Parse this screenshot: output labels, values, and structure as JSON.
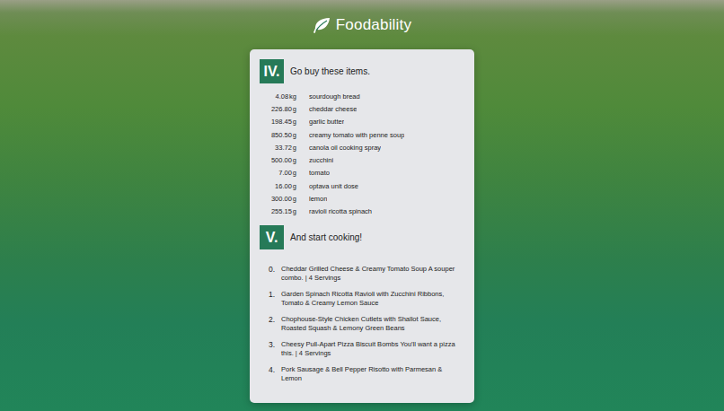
{
  "header": {
    "title": "Foodability"
  },
  "shopping": {
    "numeral": "IV.",
    "title": "Go buy these items.",
    "items": [
      {
        "amount": "4.08",
        "unit": "kg",
        "name": "sourdough bread"
      },
      {
        "amount": "226.80",
        "unit": "g",
        "name": "cheddar cheese"
      },
      {
        "amount": "198.45",
        "unit": "g",
        "name": "garlic butter"
      },
      {
        "amount": "850.50",
        "unit": "g",
        "name": "creamy tomato with penne soup"
      },
      {
        "amount": "33.72",
        "unit": "g",
        "name": "canola oil cooking spray"
      },
      {
        "amount": "500.00",
        "unit": "g",
        "name": "zucchini"
      },
      {
        "amount": "7.00",
        "unit": "g",
        "name": "tomato"
      },
      {
        "amount": "16.00",
        "unit": "g",
        "name": "optava unit dose"
      },
      {
        "amount": "300.00",
        "unit": "g",
        "name": "lemon"
      },
      {
        "amount": "255.15",
        "unit": "g",
        "name": "ravioli ricotta spinach"
      }
    ]
  },
  "cooking": {
    "numeral": "V.",
    "title": "And start cooking!",
    "recipes": [
      {
        "number": "0.",
        "name": "Cheddar Grilled Cheese & Creamy Tomato Soup A souper combo. | 4 Servings"
      },
      {
        "number": "1.",
        "name": "Garden Spinach Ricotta Ravioli with Zucchini Ribbons, Tomato & Creamy Lemon Sauce"
      },
      {
        "number": "2.",
        "name": "Chophouse-Style Chicken Cutlets with Shallot Sauce, Roasted Squash & Lemony Green Beans"
      },
      {
        "number": "3.",
        "name": "Cheesy Pull-Apart Pizza Biscuit Bombs You'll want a pizza this. | 4 Servings"
      },
      {
        "number": "4.",
        "name": "Pork Sausage & Bell Pepper Risotto with Parmesan & Lemon"
      }
    ]
  }
}
